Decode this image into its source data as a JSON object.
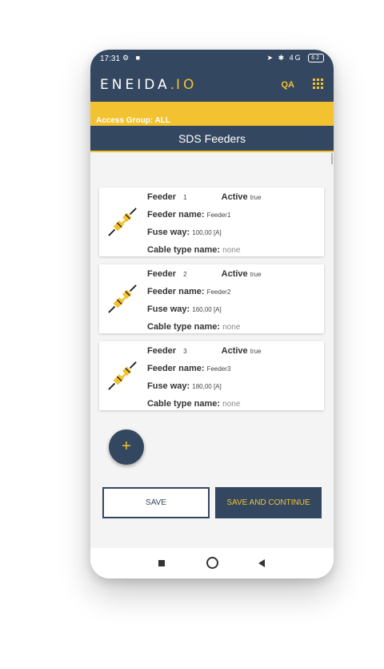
{
  "status_bar": {
    "time": "17:31",
    "signal": "4G",
    "battery": "62"
  },
  "app_bar": {
    "logo_main": "ENEIDA",
    "logo_dot": ".",
    "logo_suffix": "IO",
    "qa_label": "QA"
  },
  "access_group": "Access Group: ALL",
  "page_title": "SDS Feeders",
  "feeder_labels": {
    "feeder": "Feeder",
    "active": "Active",
    "feeder_name": "Feeder name:",
    "fuse_way": "Fuse way:",
    "cable_type_name": "Cable type name:"
  },
  "feeders": [
    {
      "number": "1",
      "active": "true",
      "name": "Feeder1",
      "fuse_way": "100,00 [A]",
      "cable_type": "none"
    },
    {
      "number": "2",
      "active": "true",
      "name": "Feeder2",
      "fuse_way": "160,00 [A]",
      "cable_type": "none"
    },
    {
      "number": "3",
      "active": "true",
      "name": "Feeder3",
      "fuse_way": "180,00 [A]",
      "cable_type": "none"
    }
  ],
  "fab_label": "+",
  "buttons": {
    "save": "SAVE",
    "save_continue": "SAVE AND CONTINUE"
  },
  "colors": {
    "primary": "#344760",
    "accent": "#f2c230",
    "background": "#f4f4f4"
  },
  "icons": [
    "plug-icon",
    "grid-menu-icon",
    "add-icon",
    "nav-recents-icon",
    "nav-home-icon",
    "nav-back-icon"
  ]
}
